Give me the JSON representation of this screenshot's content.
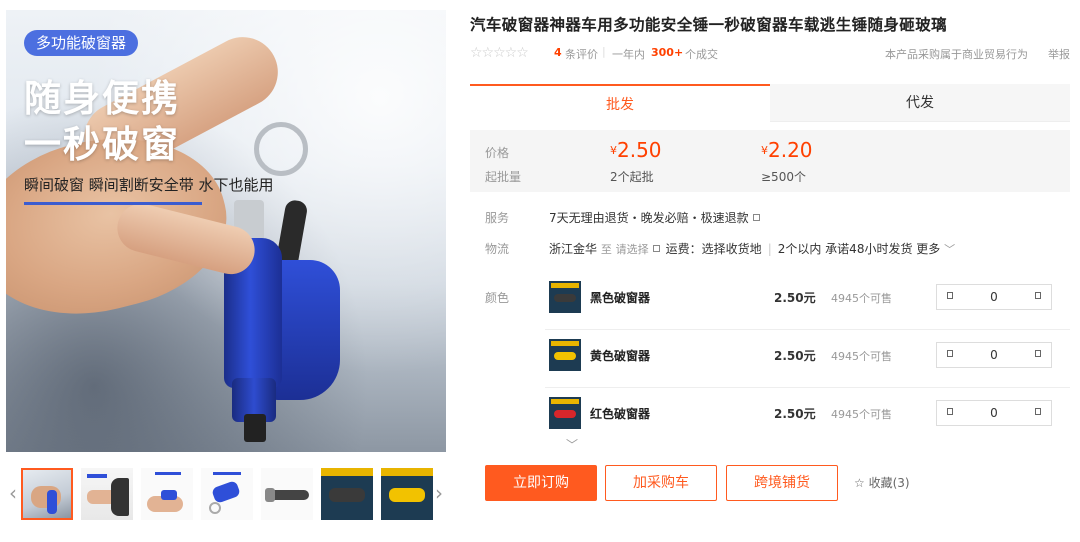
{
  "gallery": {
    "badge": "多功能破窗器",
    "headline_line1": "随身便携",
    "headline_line2": "一秒破窗",
    "subline": "瞬间破窗 瞬间割断安全带 水下也能用",
    "prev_glyph": "‹",
    "next_glyph": "›",
    "thumbnails": [
      {
        "name": "thumb-hand-keyring"
      },
      {
        "name": "thumb-car-door"
      },
      {
        "name": "thumb-hand-hold"
      },
      {
        "name": "thumb-keyring-blue"
      },
      {
        "name": "thumb-black-tool"
      },
      {
        "name": "thumb-black-package"
      },
      {
        "name": "thumb-yellow-package"
      }
    ]
  },
  "product": {
    "title": "汽车破窗器神器车用多功能安全锤一秒破窗器车载逃生锤随身砸玻璃",
    "stars": "☆☆☆☆☆",
    "review_count": "4",
    "review_label": "条评价",
    "separator": "|",
    "year_label": "一年内",
    "sold_count": "300+",
    "sold_label": "个成交",
    "b2b_note": "本产品采购属于商业贸易行为",
    "report_link": "举报"
  },
  "tabs": {
    "wholesale": "批发",
    "dropship": "代发"
  },
  "pricing": {
    "price_label": "价格",
    "moq_label": "起批量",
    "currency": "¥",
    "tiers": [
      {
        "price": "2.50",
        "qty": "2个起批"
      },
      {
        "price": "2.20",
        "qty": "≥500个"
      }
    ]
  },
  "service": {
    "label": "服务",
    "value": "7天无理由退货・晚发必赔・极速退款"
  },
  "logistics": {
    "label": "物流",
    "origin": "浙江金华",
    "to": "至",
    "destination_placeholder": "请选择",
    "fee": "运费：选择收货地",
    "promise": "2个以内 承诺48小时发货",
    "more": "更多"
  },
  "sku": {
    "label": "颜色",
    "items": [
      {
        "name": "黑色破窗器",
        "price": "2.50元",
        "stock": "4945个可售",
        "qty": "0",
        "swatch": "#3a3a3a"
      },
      {
        "name": "黄色破窗器",
        "price": "2.50元",
        "stock": "4945个可售",
        "qty": "0",
        "swatch": "#f2c200"
      },
      {
        "name": "红色破窗器",
        "price": "2.50元",
        "stock": "4945个可售",
        "qty": "0",
        "swatch": "#d8262b"
      }
    ],
    "expand_glyph": "﹀"
  },
  "actions": {
    "buy_now": "立即订购",
    "add_cart": "加采购车",
    "cross_border": "跨境铺货",
    "favorite": "收藏(3)",
    "favorite_icon": "☆"
  },
  "colors": {
    "accent": "#ff5a1f",
    "price": "#ff4000",
    "badge": "#4c6fe0"
  }
}
